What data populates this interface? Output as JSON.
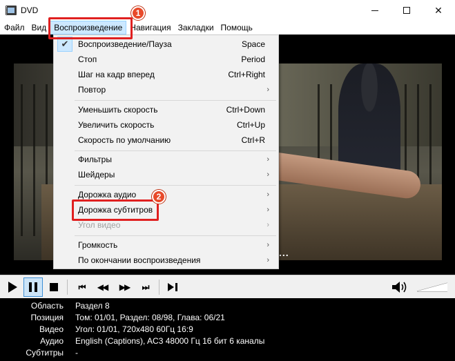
{
  "window": {
    "title": "DVD"
  },
  "menubar": {
    "items": [
      "Файл",
      "Вид",
      "Воспроизведение",
      "Навигация",
      "Закладки",
      "Помощь"
    ]
  },
  "playback_menu": {
    "items": [
      {
        "label": "Воспроизведение/Пауза",
        "shortcut": "Space",
        "checked": true
      },
      {
        "label": "Стоп",
        "shortcut": "Period"
      },
      {
        "label": "Шаг на кадр вперед",
        "shortcut": "Ctrl+Right"
      },
      {
        "label": "Повтор",
        "submenu": true
      },
      {
        "label": "Уменьшить скорость",
        "shortcut": "Ctrl+Down"
      },
      {
        "label": "Увеличить скорость",
        "shortcut": "Ctrl+Up"
      },
      {
        "label": "Скорость по умолчанию",
        "shortcut": "Ctrl+R"
      },
      {
        "label": "Фильтры",
        "submenu": true
      },
      {
        "label": "Шейдеры",
        "submenu": true
      },
      {
        "label": "Дорожка аудио",
        "submenu": true
      },
      {
        "label": "Дорожка субтитров",
        "submenu": true
      },
      {
        "label": "Угол видео",
        "submenu": true,
        "disabled": true
      },
      {
        "label": "Громкость",
        "submenu": true
      },
      {
        "label": "По окончании воспроизведения",
        "submenu": true
      }
    ],
    "check_glyph": "✔",
    "arrow_glyph": "›"
  },
  "annotations": {
    "step1": "1",
    "step2": "2",
    "color": "#e02020"
  },
  "video": {
    "overlay_text": "..."
  },
  "info_panel": {
    "rows": [
      {
        "key": "Область",
        "value": "Раздел 8"
      },
      {
        "key": "Позиция",
        "value": "Том: 01/01, Раздел: 08/98, Глава: 06/21"
      },
      {
        "key": "Видео",
        "value": "Угол: 01/01, 720x480 60Гц 16:9"
      },
      {
        "key": "Аудио",
        "value": "English (Captions), AC3 48000 Гц 16 бит 6 каналы"
      },
      {
        "key": "Субтитры",
        "value": "-"
      }
    ]
  },
  "controls": {
    "volume_level": 1.0
  },
  "icons": {
    "window_close": "✕",
    "skip_back": "⏮",
    "rewind": "◀◀",
    "forward": "▶▶",
    "skip_forward": "⏭"
  }
}
